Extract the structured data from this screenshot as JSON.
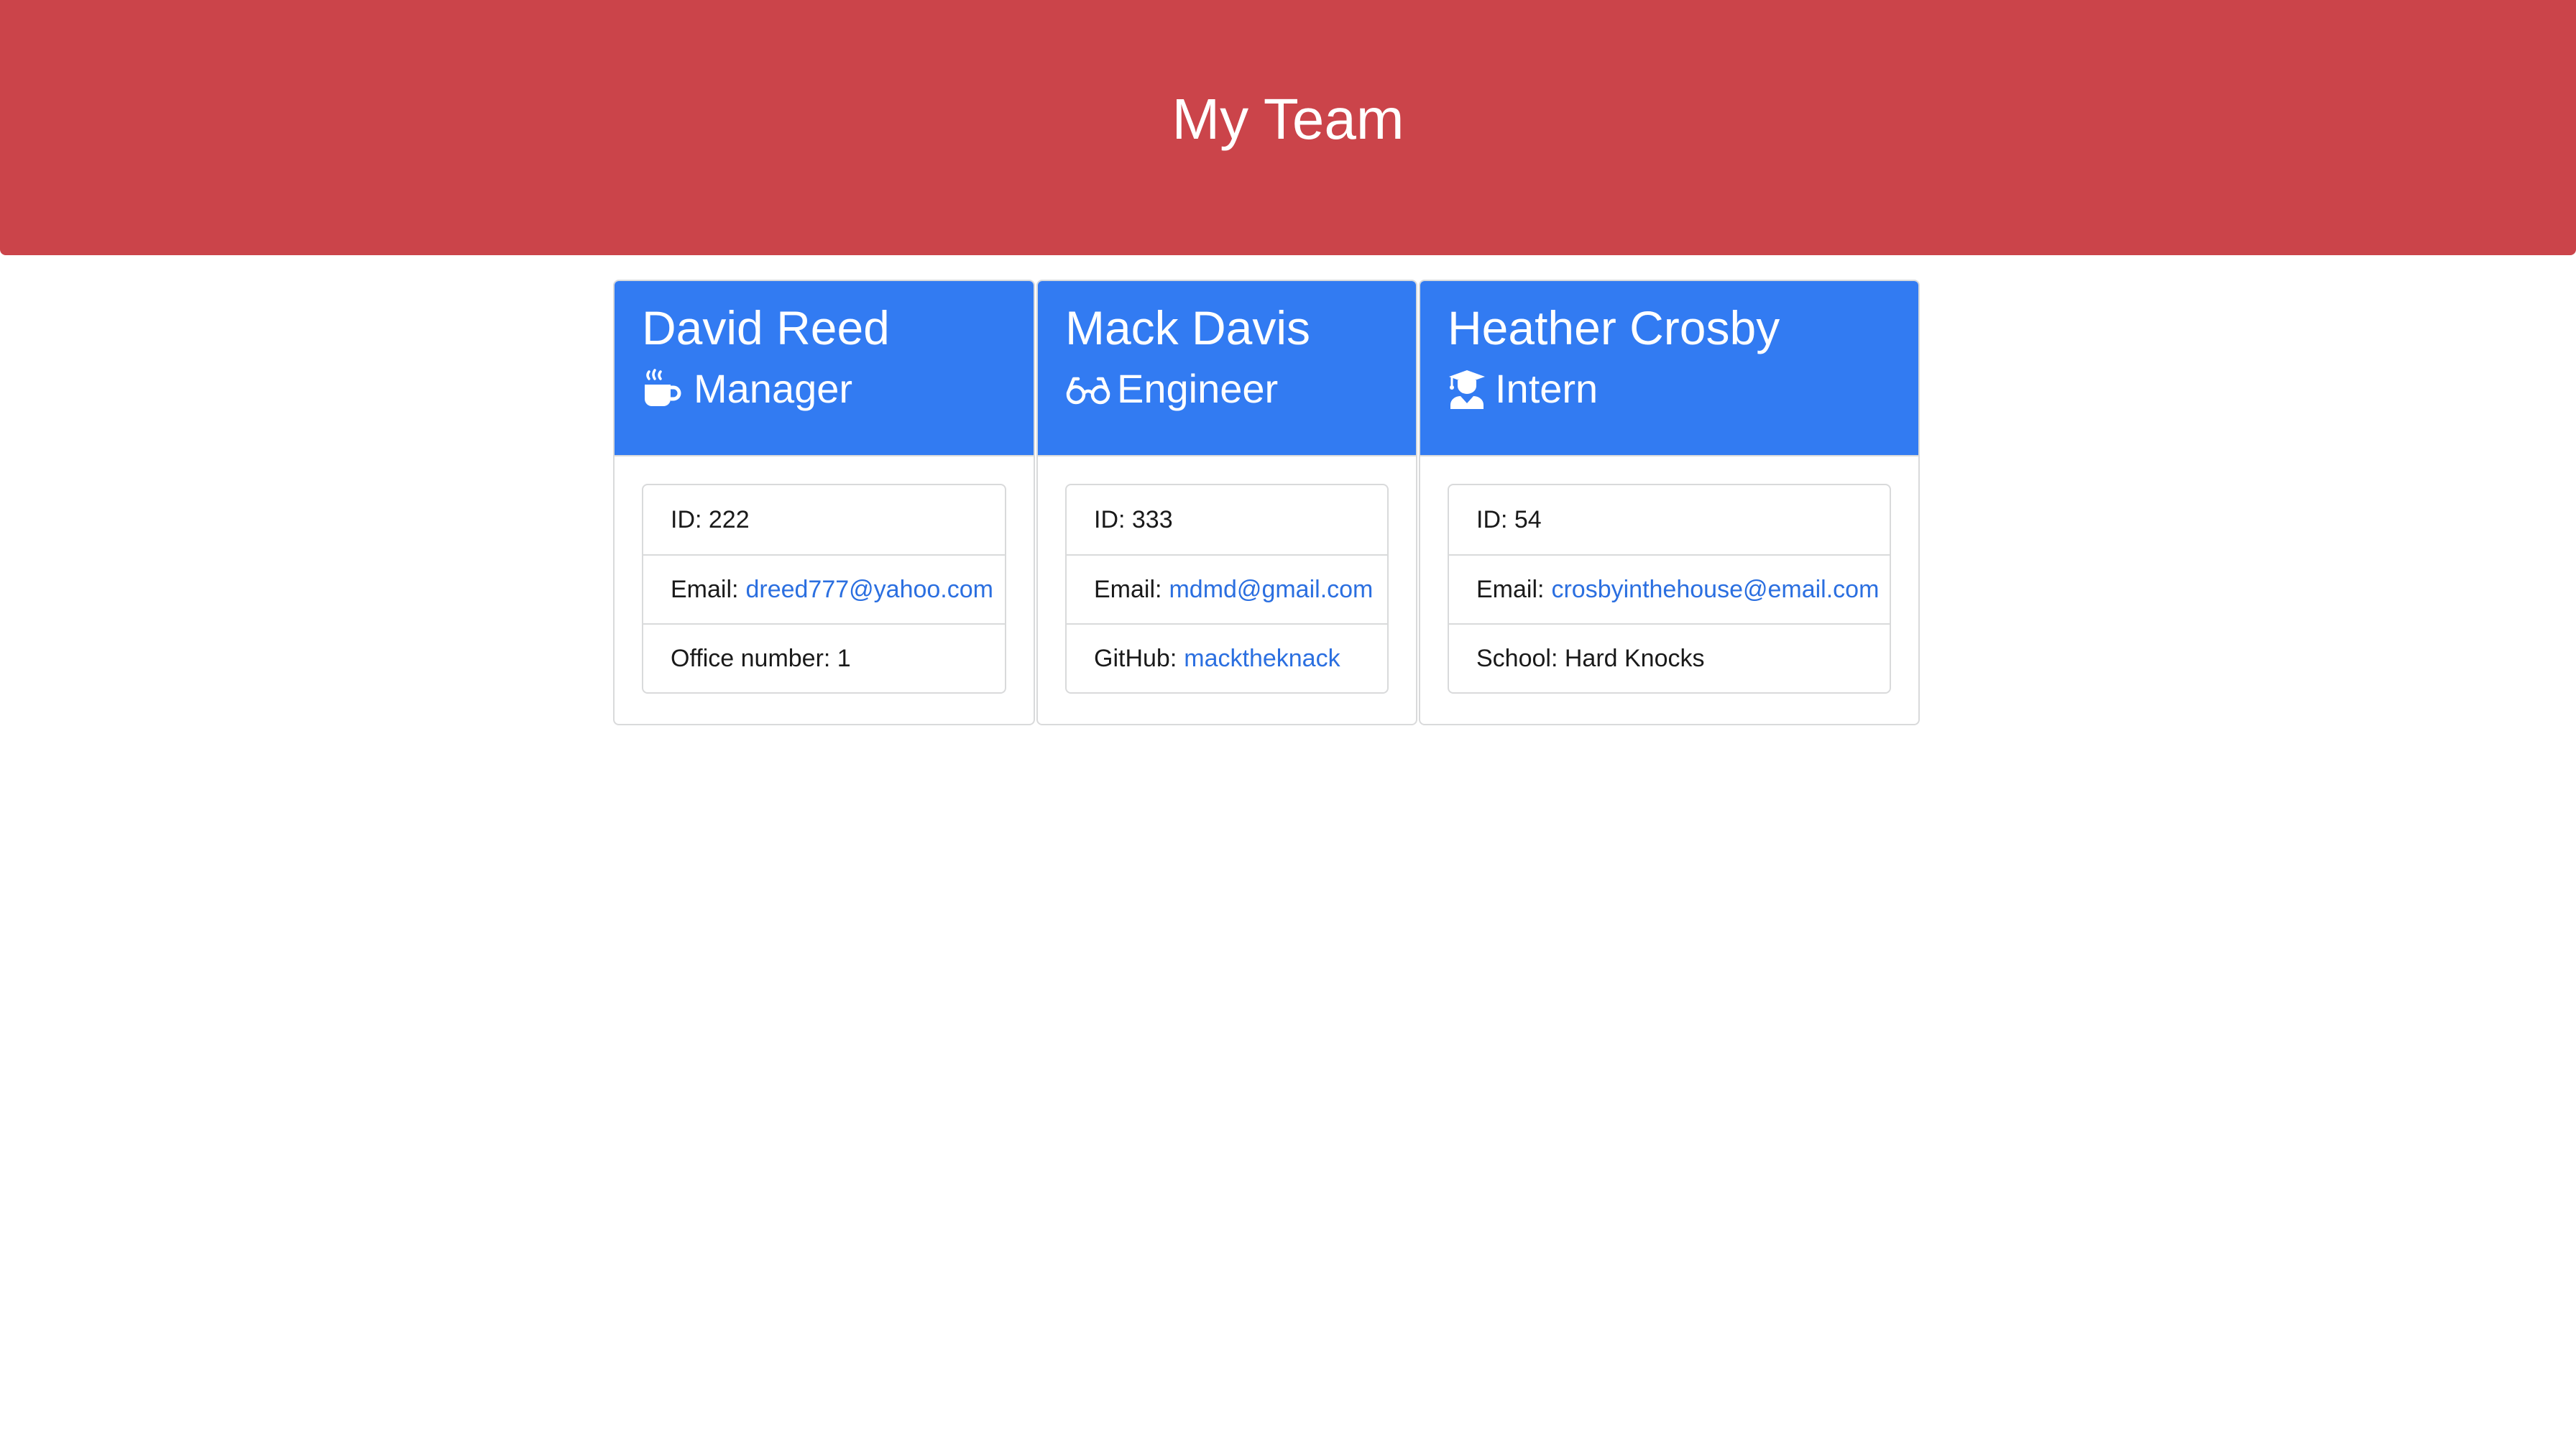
{
  "header": {
    "title": "My Team"
  },
  "colors": {
    "header_bg": "#cb444a",
    "card_head_bg": "#327bf2",
    "link": "#2b6fe0"
  },
  "cards": [
    {
      "name": "David Reed",
      "role": "Manager",
      "icon": "mug-hot-icon",
      "id_label": "ID: 222",
      "email_label": "Email:",
      "email": "dreed777@yahoo.com",
      "extra_label": "Office number: 1"
    },
    {
      "name": "Mack Davis",
      "role": "Engineer",
      "icon": "glasses-icon",
      "id_label": "ID: 333",
      "email_label": "Email:",
      "email": "mdmd@gmail.com",
      "extra_label": "GitHub:",
      "extra_link": "macktheknack"
    },
    {
      "name": "Heather Crosby",
      "role": "Intern",
      "icon": "user-graduate-icon",
      "id_label": "ID: 54",
      "email_label": "Email:",
      "email": "crosbyinthehouse@email.com",
      "extra_label": "School: Hard Knocks"
    }
  ]
}
